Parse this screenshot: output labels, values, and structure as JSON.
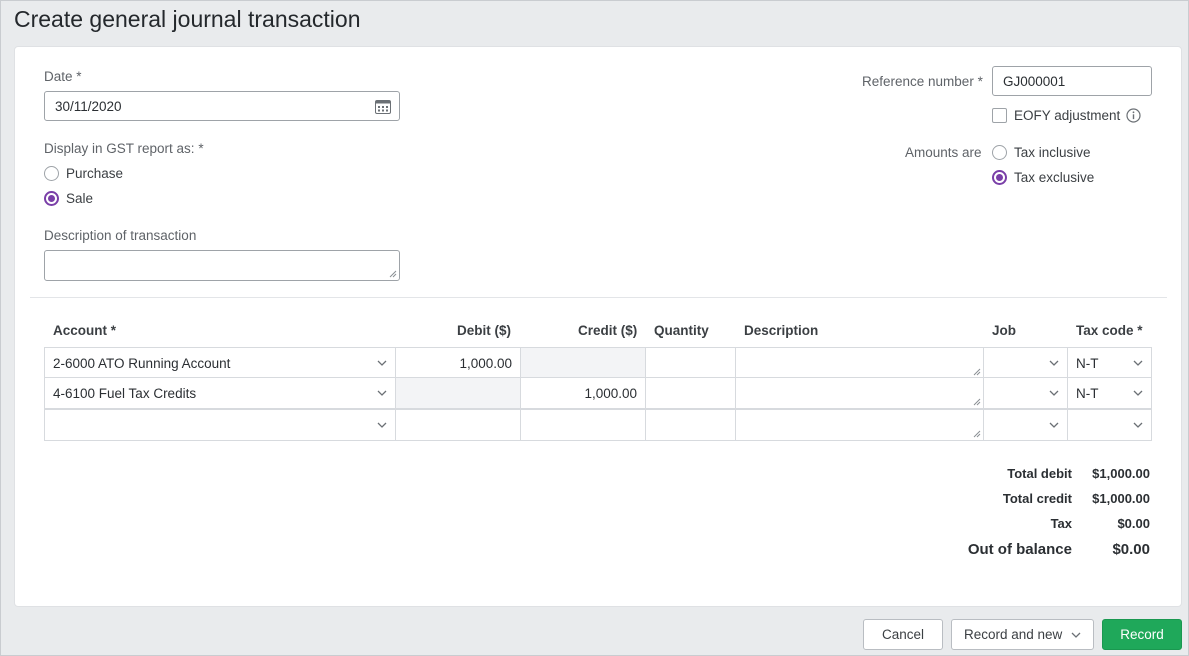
{
  "page": {
    "title": "Create general journal transaction"
  },
  "form": {
    "date": {
      "label": "Date",
      "value": "30/11/2020"
    },
    "gst_report": {
      "label": "Display in GST report as:",
      "options": [
        {
          "label": "Purchase",
          "selected": false
        },
        {
          "label": "Sale",
          "selected": true
        }
      ]
    },
    "description": {
      "label": "Description of transaction",
      "value": ""
    },
    "reference": {
      "label": "Reference number",
      "value": "GJ000001"
    },
    "eofy": {
      "label": "EOFY adjustment",
      "checked": false
    },
    "amounts_are": {
      "label": "Amounts are",
      "options": [
        {
          "label": "Tax inclusive",
          "selected": false
        },
        {
          "label": "Tax exclusive",
          "selected": true
        }
      ]
    }
  },
  "table": {
    "headers": {
      "account": "Account *",
      "debit": "Debit ($)",
      "credit": "Credit ($)",
      "quantity": "Quantity",
      "description": "Description",
      "job": "Job",
      "tax_code": "Tax code *"
    },
    "rows": [
      {
        "account": "2-6000 ATO Running Account",
        "debit": "1,000.00",
        "credit": "",
        "quantity": "",
        "description": "",
        "job": "",
        "tax_code": "N-T"
      },
      {
        "account": "4-6100 Fuel Tax Credits",
        "debit": "",
        "credit": "1,000.00",
        "quantity": "",
        "description": "",
        "job": "",
        "tax_code": "N-T"
      },
      {
        "account": "",
        "debit": "",
        "credit": "",
        "quantity": "",
        "description": "",
        "job": "",
        "tax_code": ""
      }
    ]
  },
  "totals": {
    "total_debit": {
      "label": "Total debit",
      "value": "$1,000.00"
    },
    "total_credit": {
      "label": "Total credit",
      "value": "$1,000.00"
    },
    "tax": {
      "label": "Tax",
      "value": "$0.00"
    },
    "out_of_balance": {
      "label": "Out of balance",
      "value": "$0.00"
    }
  },
  "footer": {
    "cancel": "Cancel",
    "record_and_new": "Record and new",
    "record": "Record"
  },
  "colors": {
    "accent": "#7a3fa8",
    "primary_button": "#1fa85a"
  }
}
